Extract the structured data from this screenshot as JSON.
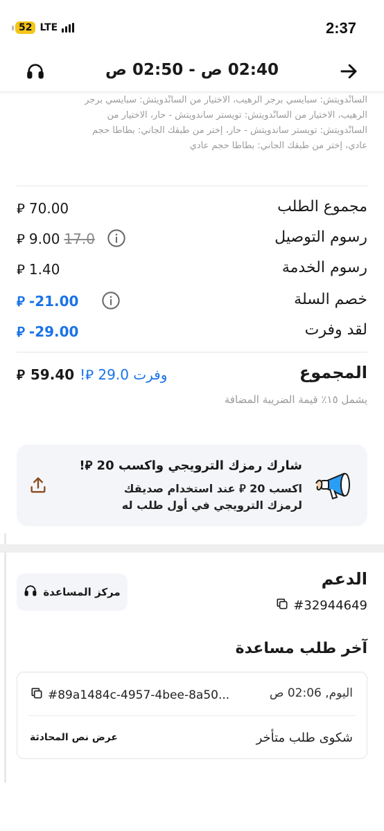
{
  "status_bar": {
    "battery": "52",
    "network": "LTE",
    "time": "2:37"
  },
  "header": {
    "title": "02:40 ص - 02:50 ص"
  },
  "items_text": "السانْدويتش: سبايسي برجر الرهيب، الاختيار من السانْدويتش: سبايسي برجر الرهيب، الاختيار من السانْدويتش: تويستر ساندويتش - حار، الاختيار من السانْدويتش: تويستر ساندويتش - حار، إختر من طبقك الجاني: بطاطا حجم عادي، إختر من طبقك الجاني: بطاطا حجم عادي",
  "currency": "⃁",
  "price_rows": [
    {
      "label": "مجموع الطلب",
      "value": "70.00",
      "highlight": false
    },
    {
      "label": "رسوم التوصيل",
      "value": "9.00",
      "original": "17.0",
      "info": true,
      "highlight": false
    },
    {
      "label": "رسوم الخدمة",
      "value": "1.40",
      "highlight": false
    },
    {
      "label": "خصم السلة",
      "value": "-21.00",
      "info": true,
      "highlight": true
    },
    {
      "label": "لقد وفرت",
      "value": "-29.00",
      "highlight": true
    }
  ],
  "total": {
    "label": "المجموع",
    "value": "59.40",
    "saved_note": "وفرت 29.0 ⃁!",
    "vat_note": "يشمل ١٥٪ قيمة الضريبة المضافة"
  },
  "promo": {
    "title": "شارك رمزك الترويجي واكسب 20 ⃁!",
    "description": "اكسب 20 ⃁ عند استخدام صديقك لرمزك الترويجي في أول طلب له"
  },
  "support": {
    "title": "الدعم",
    "order_id": "#32944649",
    "help_center_label": "مركز المساعدة",
    "last_request_title": "آخر طلب مساعدة",
    "request": {
      "date": "اليوم, 02:06 ص",
      "id": "#89a1484c-4957-4bee-8a50...",
      "type": "شكوى طلب متأخر",
      "view_chat_label": "عرض نص المحادثة"
    }
  },
  "colors": {
    "accent_blue": "#1a73e8",
    "battery_yellow": "#f5c518",
    "promo_bg": "#f4f5f8"
  }
}
